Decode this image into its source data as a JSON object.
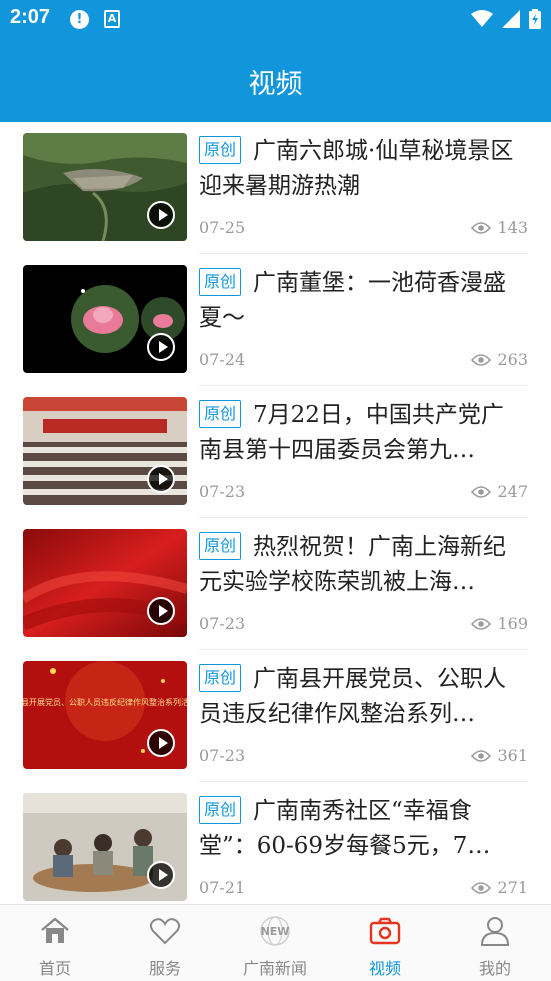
{
  "status_bar": {
    "time": "2:07",
    "alert_glyph": "!",
    "a_glyph": "A"
  },
  "header": {
    "title": "视频"
  },
  "badge_label": "原创",
  "items": [
    {
      "title": "广南六郎城·仙草秘境景区迎来暑期游热潮",
      "date": "07-25",
      "views": "143",
      "thumb": "green-village"
    },
    {
      "title": "广南董堡：一池荷香漫盛夏～",
      "date": "07-24",
      "views": "263",
      "thumb": "lotus-black"
    },
    {
      "title": "7月22日，中国共产党广南县第十四届委员会第九…",
      "date": "07-23",
      "views": "247",
      "thumb": "meeting-hall"
    },
    {
      "title": "热烈祝贺！广南上海新纪元实验学校陈荣凯被上海…",
      "date": "07-23",
      "views": "169",
      "thumb": "red-silk"
    },
    {
      "title": "广南县开展党员、公职人员违反纪律作风整治系列…",
      "date": "07-23",
      "views": "361",
      "thumb": "red-banner"
    },
    {
      "title": "广南南秀社区“幸福食堂”：60-69岁每餐5元，7…",
      "date": "07-21",
      "views": "271",
      "thumb": "dining-room"
    }
  ],
  "thumb_texts": {
    "banner": "南县开展党员、公职人员违反纪律作风整治系列活动"
  },
  "tabs": [
    {
      "label": "首页",
      "icon": "home-icon",
      "active": false
    },
    {
      "label": "服务",
      "icon": "heart-icon",
      "active": false
    },
    {
      "label": "广南新闻",
      "icon": "new-globe-icon",
      "active": false,
      "icon_text": "NEW"
    },
    {
      "label": "视频",
      "icon": "camera-icon",
      "active": true
    },
    {
      "label": "我的",
      "icon": "user-icon",
      "active": false
    }
  ],
  "colors": {
    "brand": "#1296db",
    "text": "#222222",
    "meta": "#9a9a9a"
  }
}
